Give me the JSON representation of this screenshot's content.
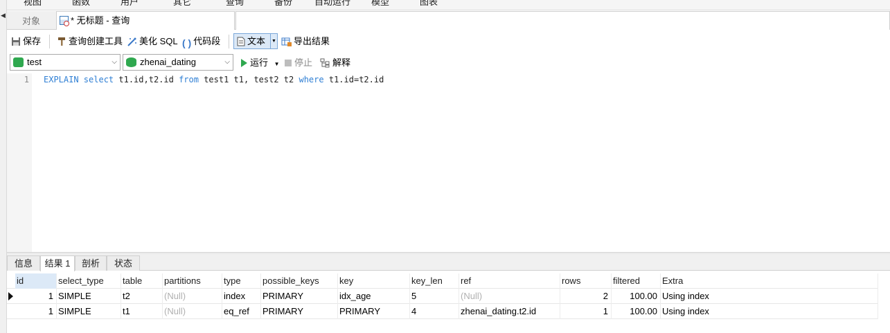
{
  "menu": [
    "视图",
    "函数",
    "用户",
    "其它",
    "查询",
    "备份",
    "自动运行",
    "模型",
    "图表"
  ],
  "tabs": {
    "objects": "对象",
    "query": "* 无标题 - 查询"
  },
  "toolbar": {
    "save": "保存",
    "query_builder": "查询创建工具",
    "beautify": "美化 SQL",
    "snippet": "代码段",
    "text": "文本",
    "export": "导出结果"
  },
  "toolbar2": {
    "connection": "test",
    "database": "zhenai_dating",
    "run": "运行",
    "stop": "停止",
    "explain": "解释"
  },
  "editor": {
    "line_number": "1",
    "tokens": [
      {
        "t": "EXPLAIN ",
        "kw": true
      },
      {
        "t": "select ",
        "kw": true
      },
      {
        "t": "t1.id,t2.id ",
        "kw": false
      },
      {
        "t": "from ",
        "kw": true
      },
      {
        "t": "test1 t1, test2 t2 ",
        "kw": false
      },
      {
        "t": "where ",
        "kw": true
      },
      {
        "t": "t1.id=t2.id",
        "kw": false
      }
    ]
  },
  "result_tabs": [
    "信息",
    "结果 1",
    "剖析",
    "状态"
  ],
  "result_table": {
    "columns": [
      "id",
      "select_type",
      "table",
      "partitions",
      "type",
      "possible_keys",
      "key",
      "key_len",
      "ref",
      "rows",
      "filtered",
      "Extra"
    ],
    "rows": [
      [
        "1",
        "SIMPLE",
        "t2",
        "(Null)",
        "index",
        "PRIMARY",
        "idx_age",
        "5",
        "(Null)",
        "2",
        "100.00",
        "Using index"
      ],
      [
        "1",
        "SIMPLE",
        "t1",
        "(Null)",
        "eq_ref",
        "PRIMARY",
        "PRIMARY",
        "4",
        "zhenai_dating.t2.id",
        "1",
        "100.00",
        "Using index"
      ]
    ]
  },
  "colors": {
    "keyword": "#2f7fd4",
    "null_text": "#b0b0b0",
    "selected_header": "#dce9f7",
    "run_green": "#2fa84f"
  }
}
